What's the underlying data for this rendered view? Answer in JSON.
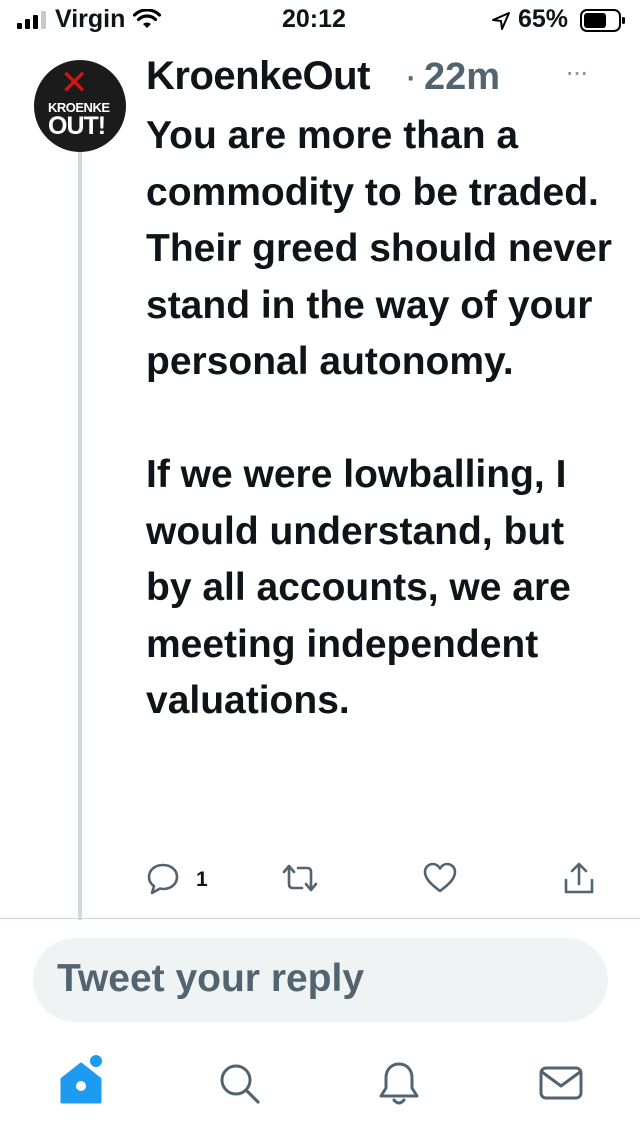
{
  "status_bar": {
    "carrier": "Virgin",
    "time": "20:12",
    "battery_percent": "65%",
    "battery_level": 0.65,
    "icons": [
      "signal-icon",
      "wifi-icon",
      "location-icon",
      "battery-icon"
    ]
  },
  "tweet": {
    "author": "KroenkeOut",
    "separator": "·",
    "time_ago": "22m",
    "more": "···",
    "avatar_text_top": "KROENKE",
    "avatar_text_bottom": "OUT!",
    "text": "You are more than a commodity to be traded. Their greed should never stand in the way of your personal autonomy.\n\nIf we were lowballing, I would understand, but by all accounts, we are meeting independent valuations.",
    "reply_count": "1",
    "action_icons": [
      "reply-icon",
      "retweet-icon",
      "like-icon",
      "share-icon"
    ]
  },
  "reply_box": {
    "placeholder": "Tweet your reply"
  },
  "tab_bar": {
    "tabs": [
      "home-icon",
      "search-icon",
      "notifications-icon",
      "messages-icon"
    ]
  },
  "colors": {
    "accent": "#1d9bf0",
    "secondary_text": "#536471",
    "text": "#0f1419"
  }
}
